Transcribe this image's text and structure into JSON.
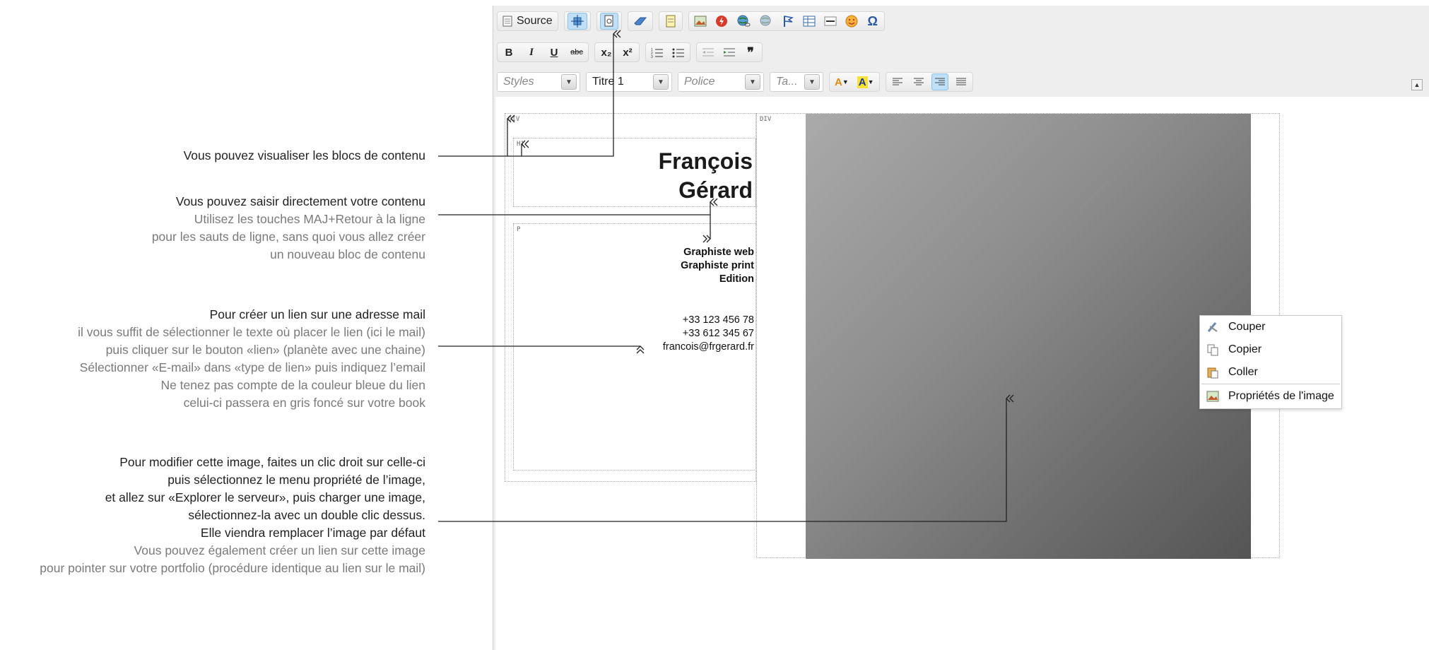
{
  "annotations": {
    "a1": {
      "dark": [
        "Vous pouvez visualiser les blocs de contenu"
      ],
      "light": []
    },
    "a2": {
      "dark": [
        "Vous pouvez saisir directement votre contenu"
      ],
      "light": [
        "Utilisez les touches MAJ+Retour à la ligne",
        "pour les sauts de ligne, sans quoi vous allez créer",
        "un nouveau bloc de contenu"
      ]
    },
    "a3": {
      "dark": [
        "Pour créer un lien sur une adresse mail"
      ],
      "light": [
        "il vous suffit de sélectionner le texte où placer le lien (ici le mail)",
        "puis cliquer sur le bouton «lien» (planète avec une chaine)",
        "Sélectionner «E-mail» dans «type de lien» puis indiquez l’email",
        "Ne tenez pas compte de la couleur bleue du lien",
        "celui-ci passera en gris foncé sur votre book"
      ]
    },
    "a4": {
      "dark": [
        "Pour modifier cette image, faites un clic droit sur celle-ci",
        "puis sélectionnez le menu propriété de l’image,",
        "et allez sur «Explorer le serveur», puis charger une image,",
        "sélectionnez-la avec un double clic dessus.",
        "Elle viendra remplacer l’image par défaut"
      ],
      "light": [
        "Vous pouvez également créer un lien sur cette image",
        "pour pointer sur votre portfolio (procédure identique au lien sur le mail)"
      ]
    }
  },
  "toolbar": {
    "source_label": "Source",
    "bold": "B",
    "italic": "I",
    "underline": "U",
    "strike": "abc",
    "subscript": "x₂",
    "superscript": "x²",
    "blockquote": "❞",
    "styles_placeholder": "Styles",
    "format_value": "Titre 1",
    "font_placeholder": "Police",
    "size_placeholder": "Ta...",
    "text_color_label": "A",
    "bg_color_label": "A",
    "omega": "Ω"
  },
  "content": {
    "div_tag": "DIV",
    "h1_tag": "H1",
    "p_tag": "P",
    "heading_line1": "François",
    "heading_line2": "Gérard",
    "roles": [
      "Graphiste web",
      "Graphiste print",
      "Edition"
    ],
    "phones": [
      "+33 123 456 78",
      "+33 612 345 67"
    ],
    "email": "francois@frgerard.fr"
  },
  "context_menu": {
    "items": [
      {
        "label": "Couper",
        "icon": "scissors-icon"
      },
      {
        "label": "Copier",
        "icon": "copy-icon"
      },
      {
        "label": "Coller",
        "icon": "paste-icon"
      },
      {
        "label": "Propriétés de l'image",
        "icon": "image-icon"
      }
    ]
  },
  "colors": {
    "selected_button": "#bfe0f7",
    "connector_line": "#222222"
  }
}
